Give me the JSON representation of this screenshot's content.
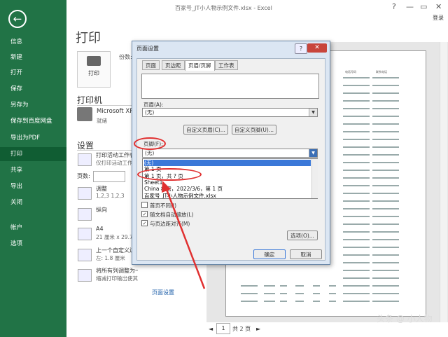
{
  "window": {
    "title": "百家号_JT小人物示例文件.xlsx - Excel",
    "signin": "登录",
    "controls": {
      "help": "?",
      "minimize": "—",
      "restore": "▭",
      "close": "✕"
    }
  },
  "sidebar": {
    "back_icon": "←",
    "items": [
      {
        "label": "信息"
      },
      {
        "label": "新建"
      },
      {
        "label": "打开"
      },
      {
        "label": "保存"
      },
      {
        "label": "另存为"
      },
      {
        "label": "保存到百度网盘"
      },
      {
        "label": "导出为PDF"
      },
      {
        "label": "打印"
      },
      {
        "label": "共享"
      },
      {
        "label": "导出"
      },
      {
        "label": "关闭"
      },
      {
        "label": "帐户"
      },
      {
        "label": "选项"
      }
    ]
  },
  "print": {
    "heading": "打印",
    "print_button": "打印",
    "copies_label": "份数:",
    "printer_heading": "打印机",
    "printer_name": "Microsoft XPS",
    "printer_status": "就绪",
    "settings_heading": "设置",
    "settings": [
      {
        "title": "打印活动工作表",
        "sub": "仅打印活动工作表"
      },
      {
        "title": "调整",
        "sub": "1,2,3    1,2,3"
      },
      {
        "title": "纵向",
        "sub": ""
      },
      {
        "title": "A4",
        "sub": "21 厘米 x 29.7 厘米"
      },
      {
        "title": "上一个自定义边距",
        "sub": "左: 1.8 厘米"
      },
      {
        "title": "将所有列调整为一页",
        "sub": "缩减打印输出使其只有一..."
      }
    ],
    "pages_label": "页数:",
    "page_setup_link": "页面设置",
    "preview_col_headers": [
      "电话号码",
      "联系电话"
    ],
    "pager_current": "1",
    "pager_total": "共 2 页"
  },
  "dialog": {
    "title": "页面设置",
    "help": "?",
    "close": "✕",
    "tabs": [
      "页面",
      "页边距",
      "页眉/页脚",
      "工作表"
    ],
    "header_label": "页眉(A):",
    "header_value": "(无)",
    "custom_header_button": "自定义页眉(C)...",
    "custom_footer_button": "自定义页脚(U)...",
    "footer_label": "页脚(F):",
    "footer_value": "(无)",
    "footer_options": [
      "(无)",
      "第 1 页",
      "第 1 页，共 ? 页",
      "Sheet1",
      "China 机密，2022/3/6，第 1 页",
      "百家号_JT小人物示例文件.xlsx"
    ],
    "selected_option_index": 0,
    "checkboxes": [
      {
        "label": "首页不同(I)",
        "checked": false
      },
      {
        "label": "随文档自动缩放(L)",
        "checked": true
      },
      {
        "label": "与页边距对齐(M)",
        "checked": true
      }
    ],
    "options_button": "选项(O)...",
    "ok_button": "确定",
    "cancel_button": "取消"
  },
  "watermark": "头条 @ 小人物",
  "colors": {
    "sidebar_bg": "#217346",
    "annotation_red": "#e03030"
  }
}
